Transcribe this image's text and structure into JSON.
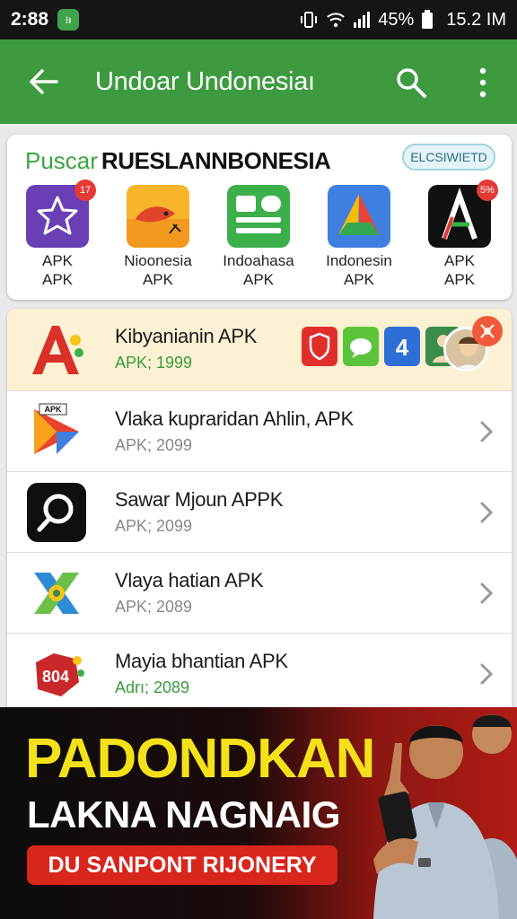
{
  "status_bar": {
    "time": "2:88",
    "notif_icon": "⁝ı",
    "battery": "45%",
    "clock": "15.2 IM"
  },
  "app_bar": {
    "title": "Undoar Undonesiaı"
  },
  "featured": {
    "heading_green": "Puscar",
    "heading_dark": "RUESLANNBONESIA",
    "badge": "ELCSIWIETD",
    "apps": [
      {
        "line1": "APK",
        "line2": "APK",
        "badge": "17",
        "icon": "star-icon"
      },
      {
        "line1": "Nioonesia",
        "line2": "APK",
        "icon": "fish-icon"
      },
      {
        "line1": "Indoahasa",
        "line2": "APK",
        "icon": "document-icon"
      },
      {
        "line1": "Indonesin",
        "line2": "APK",
        "icon": "drive-icon"
      },
      {
        "line1": "APK",
        "line2": "APK",
        "badge": "5%",
        "icon": "letter-a-icon"
      }
    ]
  },
  "list": [
    {
      "name": "Kibyanianin APK",
      "sub": "APK; 1999",
      "icon": "letter-a-icon"
    },
    {
      "name": "Vlaka kupraridan Ahlin, APK",
      "sub": "APK; 2099",
      "icon": "play-icon"
    },
    {
      "name": "Sawar Mjoun APPK",
      "sub": "APK; 2099",
      "icon": "search-lens-icon"
    },
    {
      "name": "Vlaya hatian APK",
      "sub": "APK; 2089",
      "icon": "x-shape-icon"
    },
    {
      "name": "Mayia bhantian APK",
      "sub": "Adrı; 2089",
      "icon": "puzzle-icon"
    }
  ],
  "banner": {
    "headline": "PADONDKAN",
    "subline": "LAKNA NAGNAIG",
    "cta": "DU SANPONT RIJONERY"
  },
  "colors": {
    "app_bar": "#3d9a3f",
    "accent_green": "#3aa63c",
    "highlight_row": "#fcf1d3",
    "banner_yellow": "#f5e11a",
    "banner_red": "#d8261d"
  }
}
